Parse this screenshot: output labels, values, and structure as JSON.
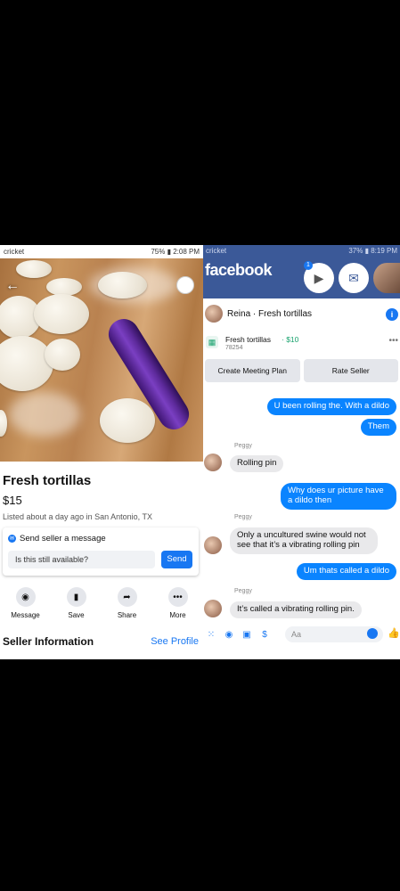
{
  "left": {
    "status": {
      "carrier": "cricket",
      "battery": "75%",
      "time": "2:08 PM"
    },
    "listing": {
      "title": "Fresh tortillas",
      "price": "$15",
      "listed": "Listed about a day ago in San Antonio, TX"
    },
    "message_card": {
      "header": "Send seller a message",
      "input_value": "Is this still available?",
      "send_label": "Send"
    },
    "actions": [
      {
        "label": "Message",
        "icon": "messenger-icon"
      },
      {
        "label": "Save",
        "icon": "bookmark-icon"
      },
      {
        "label": "Share",
        "icon": "share-icon"
      },
      {
        "label": "More",
        "icon": "more-icon"
      }
    ],
    "seller_section": {
      "title": "Seller Information",
      "link": "See Profile"
    }
  },
  "right": {
    "status": {
      "carrier": "cricket",
      "battery": "37%",
      "time": "8:19 PM"
    },
    "app_name": "facebook",
    "badge": "1",
    "chat": {
      "title": "Reina · Fresh tortillas"
    },
    "item": {
      "name": "Fresh tortillas",
      "price": "· $10",
      "id": "78254"
    },
    "buttons": {
      "meeting": "Create Meeting Plan",
      "rate": "Rate Seller"
    },
    "messages": [
      {
        "from": "me",
        "text": "U been rolling the. With a dildo"
      },
      {
        "from": "me",
        "text": "Them"
      },
      {
        "from": "Peggy",
        "sender": "Peggy",
        "text": "Rolling pin"
      },
      {
        "from": "me",
        "text": "Why does ur picture have a dildo then"
      },
      {
        "from": "Peggy",
        "sender": "Peggy",
        "text": "Only a uncultured swine would not see that it’s a vibrating rolling pin"
      },
      {
        "from": "me",
        "text": "Um thats called a dildo"
      },
      {
        "from": "Peggy",
        "sender": "Peggy",
        "text": "It’s called a vibrating rolling pin."
      }
    ],
    "composer_placeholder": "Aa"
  }
}
